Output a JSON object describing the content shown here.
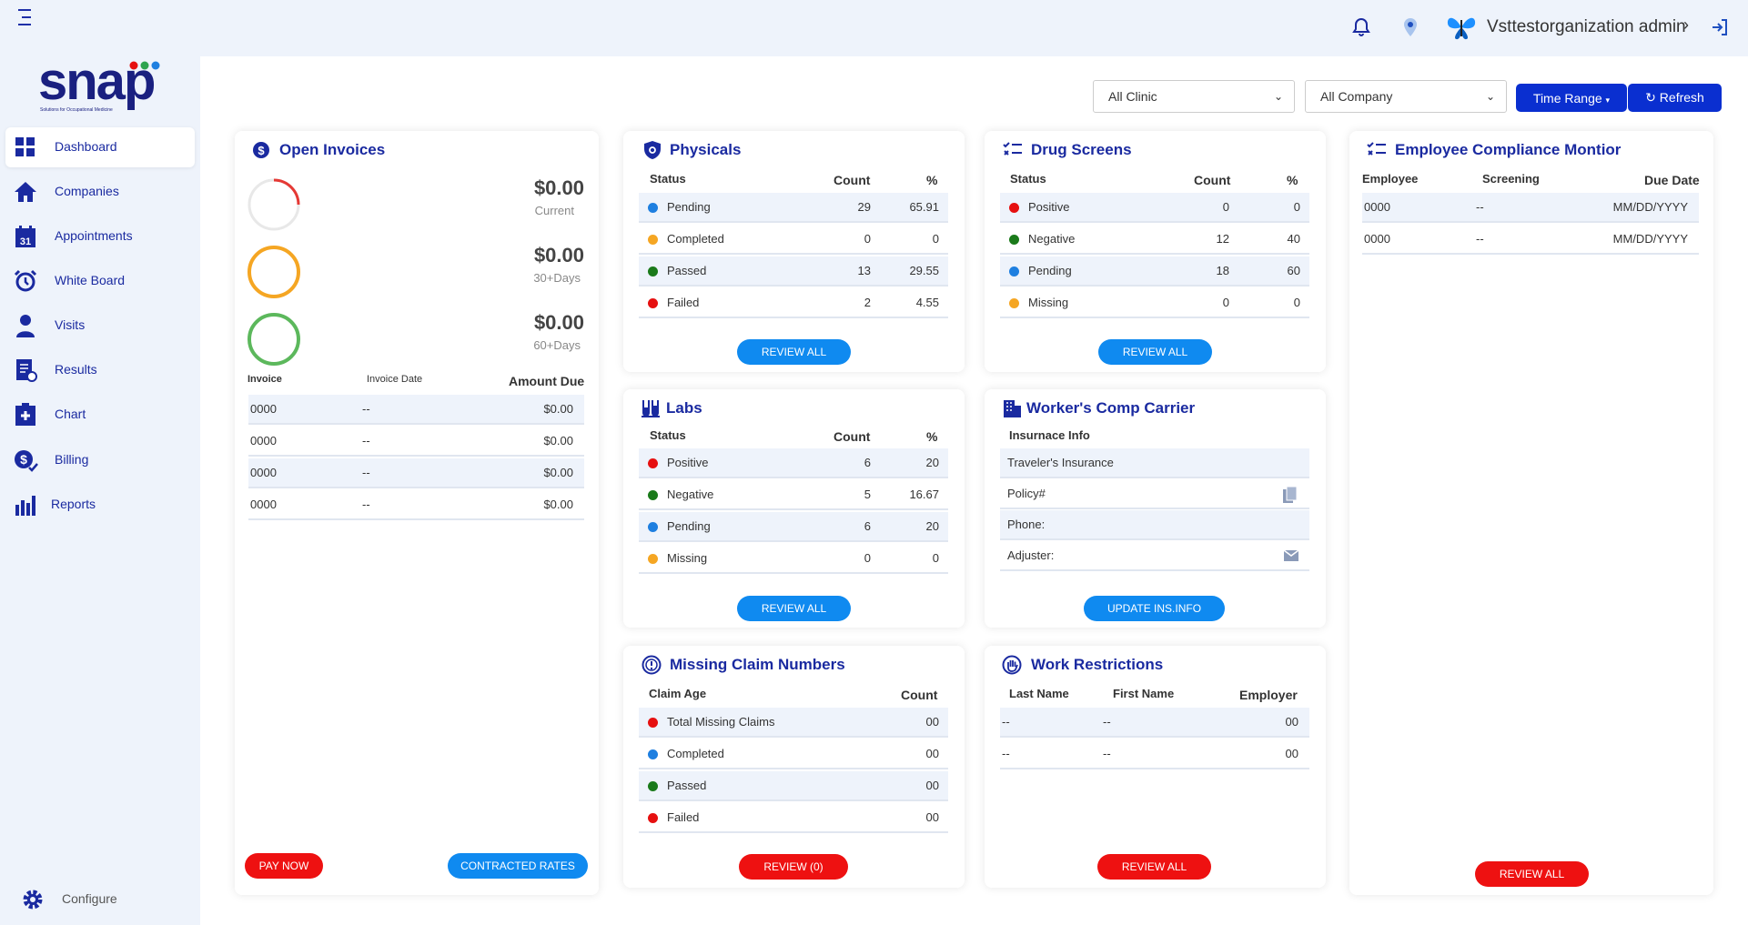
{
  "topbar": {
    "user_name": "Vsttestorganization admin"
  },
  "logo": {
    "text": "snap",
    "tagline": "Solutions for Occupational Medicine"
  },
  "sidebar": {
    "items": [
      {
        "label": "Dashboard"
      },
      {
        "label": "Companies"
      },
      {
        "label": "Appointments"
      },
      {
        "label": "White Board"
      },
      {
        "label": "Visits"
      },
      {
        "label": "Results"
      },
      {
        "label": "Chart"
      },
      {
        "label": "Billing"
      },
      {
        "label": "Reports"
      }
    ],
    "configure_label": "Configure",
    "calendar_day": "31"
  },
  "filters": {
    "clinic": "All Clinic",
    "company": "All Company",
    "time_range": "Time Range",
    "refresh": "Refresh"
  },
  "invoices": {
    "title": "Open Invoices",
    "summary": [
      {
        "amount": "$0.00",
        "label": "Current",
        "color": "#e53935"
      },
      {
        "amount": "$0.00",
        "label": "30+Days",
        "color": "#f5a623"
      },
      {
        "amount": "$0.00",
        "label": "60+Days",
        "color": "#5cb85c"
      }
    ],
    "headers": {
      "invoice": "Invoice",
      "date": "Invoice Date",
      "amount": "Amount Due"
    },
    "rows": [
      {
        "invoice": "0000",
        "date": "--",
        "amount": "$0.00"
      },
      {
        "invoice": "0000",
        "date": "--",
        "amount": "$0.00"
      },
      {
        "invoice": "0000",
        "date": "--",
        "amount": "$0.00"
      },
      {
        "invoice": "0000",
        "date": "--",
        "amount": "$0.00"
      }
    ],
    "pay_now": "PAY NOW",
    "contracted_rates": "CONTRACTED RATES"
  },
  "physicals": {
    "title": "Physicals",
    "headers": {
      "status": "Status",
      "count": "Count",
      "pct": "%"
    },
    "rows": [
      {
        "status": "Pending",
        "count": "29",
        "pct": "65.91",
        "color": "#1e7fe0"
      },
      {
        "status": "Completed",
        "count": "0",
        "pct": "0",
        "color": "#f5a623"
      },
      {
        "status": "Passed",
        "count": "13",
        "pct": "29.55",
        "color": "#1a7a1a"
      },
      {
        "status": "Failed",
        "count": "2",
        "pct": "4.55",
        "color": "#e61010"
      }
    ],
    "button": "REVIEW ALL"
  },
  "drug_screens": {
    "title": "Drug Screens",
    "headers": {
      "status": "Status",
      "count": "Count",
      "pct": "%"
    },
    "rows": [
      {
        "status": "Positive",
        "count": "0",
        "pct": "0",
        "color": "#e61010"
      },
      {
        "status": "Negative",
        "count": "12",
        "pct": "40",
        "color": "#1a7a1a"
      },
      {
        "status": "Pending",
        "count": "18",
        "pct": "60",
        "color": "#1e7fe0"
      },
      {
        "status": "Missing",
        "count": "0",
        "pct": "0",
        "color": "#f5a623"
      }
    ],
    "button": "REVIEW ALL"
  },
  "labs": {
    "title": "Labs",
    "headers": {
      "status": "Status",
      "count": "Count",
      "pct": "%"
    },
    "rows": [
      {
        "status": "Positive",
        "count": "6",
        "pct": "20",
        "color": "#e61010"
      },
      {
        "status": "Negative",
        "count": "5",
        "pct": "16.67",
        "color": "#1a7a1a"
      },
      {
        "status": "Pending",
        "count": "6",
        "pct": "20",
        "color": "#1e7fe0"
      },
      {
        "status": "Missing",
        "count": "0",
        "pct": "0",
        "color": "#f5a623"
      }
    ],
    "button": "REVIEW ALL"
  },
  "workers_comp": {
    "title": "Worker's Comp Carrier",
    "header": "Insurnace Info",
    "rows": [
      {
        "text": "Traveler's Insurance"
      },
      {
        "text": "Policy#"
      },
      {
        "text": "Phone:"
      },
      {
        "text": "Adjuster:"
      }
    ],
    "button": "UPDATE INS.INFO"
  },
  "claims": {
    "title": "Missing Claim Numbers",
    "headers": {
      "age": "Claim Age",
      "count": "Count"
    },
    "rows": [
      {
        "label": "Total Missing Claims",
        "count": "00",
        "color": "#e61010"
      },
      {
        "label": "Completed",
        "count": "00",
        "color": "#1e7fe0"
      },
      {
        "label": "Passed",
        "count": "00",
        "color": "#1a7a1a"
      },
      {
        "label": "Failed",
        "count": "00",
        "color": "#e61010"
      }
    ],
    "button": "REVIEW (0)"
  },
  "restrictions": {
    "title": "Work Restrictions",
    "headers": {
      "last": "Last Name",
      "first": "First Name",
      "employer": "Employer"
    },
    "rows": [
      {
        "last": "--",
        "first": "--",
        "employer": "00"
      },
      {
        "last": "--",
        "first": "--",
        "employer": "00"
      }
    ],
    "button": "REVIEW ALL"
  },
  "compliance": {
    "title": "Employee Compliance Montior",
    "headers": {
      "employee": "Employee",
      "screening": "Screening",
      "due": "Due Date"
    },
    "rows": [
      {
        "employee": "0000",
        "screening": "--",
        "due": "MM/DD/YYYY"
      },
      {
        "employee": "0000",
        "screening": "--",
        "due": "MM/DD/YYYY"
      }
    ],
    "button": "REVIEW ALL"
  }
}
